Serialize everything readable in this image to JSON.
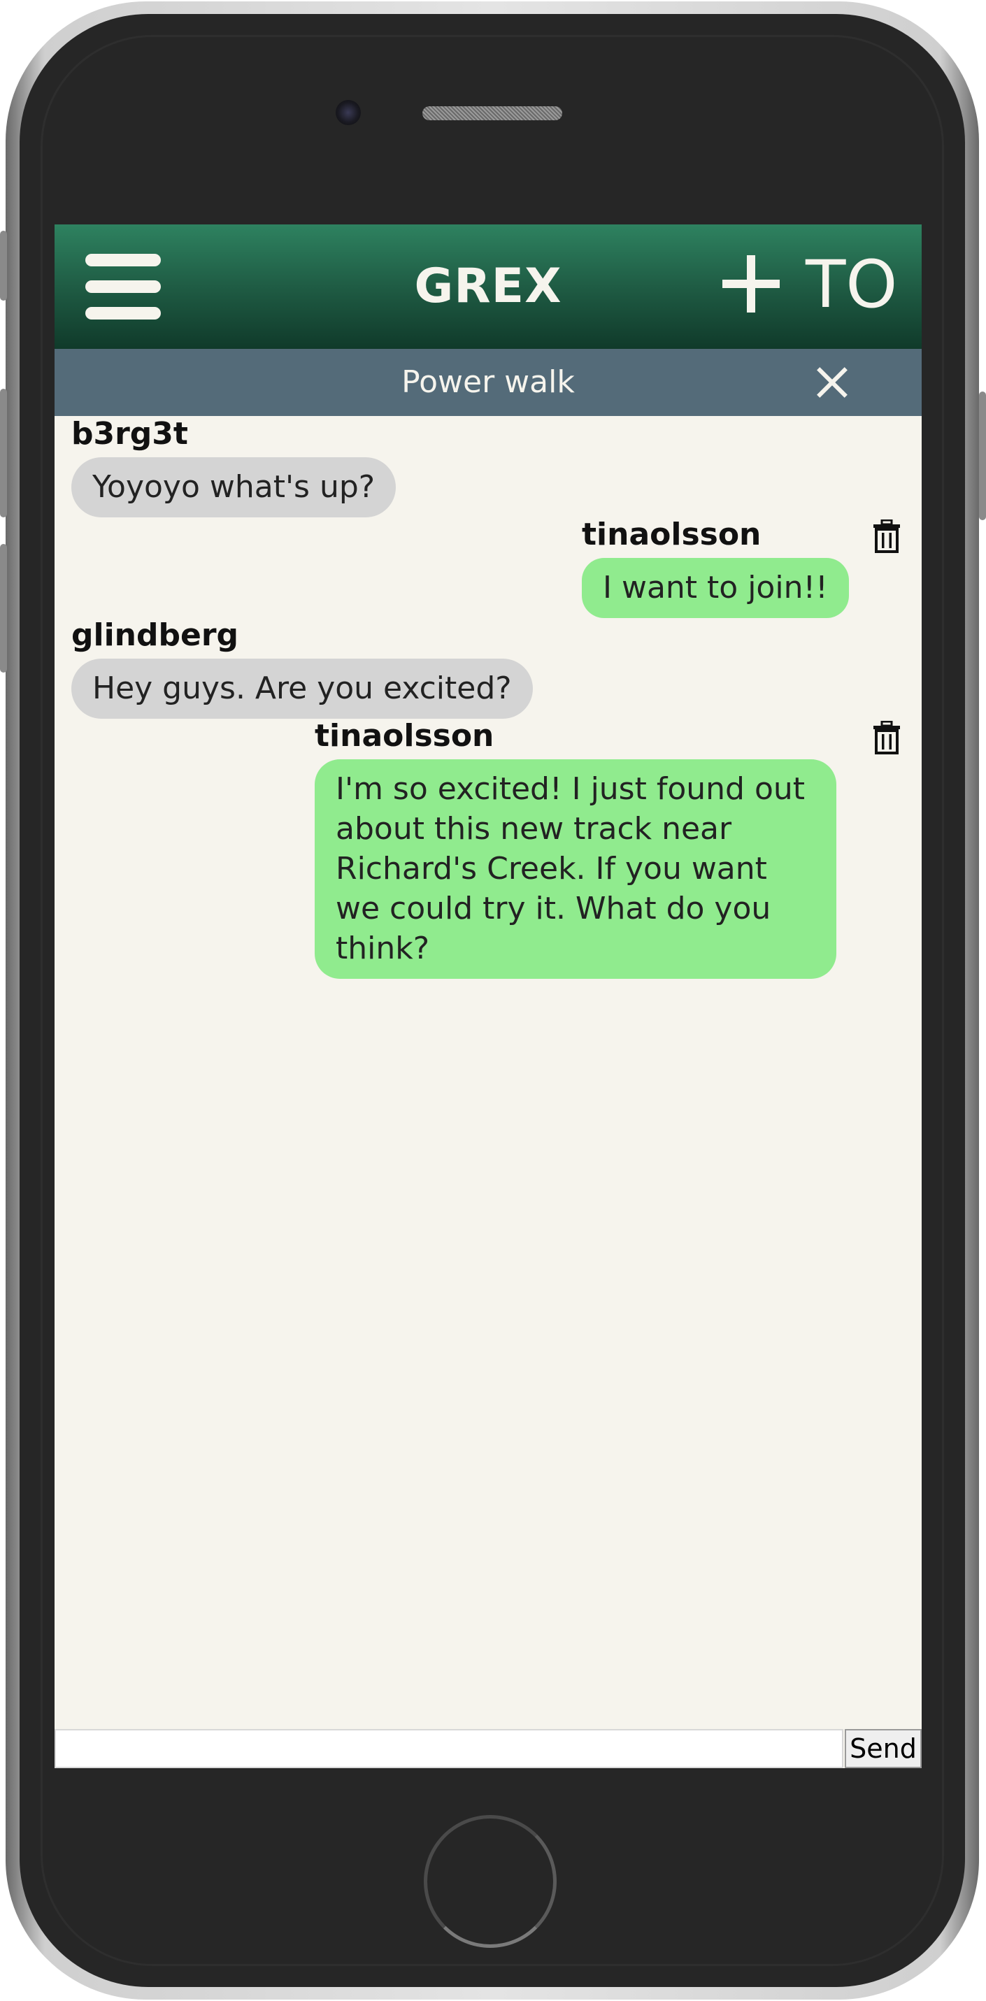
{
  "header": {
    "title": "GREX",
    "user_initials": "TO",
    "menu_icon": "hamburger-menu-icon",
    "add_icon": "plus-icon"
  },
  "group": {
    "name": "Power walk",
    "close_icon": "close-x-icon"
  },
  "messages": [
    {
      "username": "b3rg3t",
      "text": "Yoyoyo what's up?",
      "own": false
    },
    {
      "username": "tinaolsson",
      "text": "I want to join!!",
      "own": true
    },
    {
      "username": "glindberg",
      "text": "Hey guys. Are you excited?",
      "own": false
    },
    {
      "username": "tinaolsson",
      "text": "I'm so excited! I just found out about this new track near Richard's Creek. If you want we could try it. What do you think?",
      "own": true
    }
  ],
  "composer": {
    "value": "",
    "send_label": "Send"
  },
  "colors": {
    "header_top": "#2e8260",
    "header_bottom": "#103a2a",
    "group_bar": "#546b79",
    "chat_background": "#f6f4ed",
    "incoming_bubble": "#d4d4d4",
    "outgoing_bubble": "#90eb8e"
  }
}
